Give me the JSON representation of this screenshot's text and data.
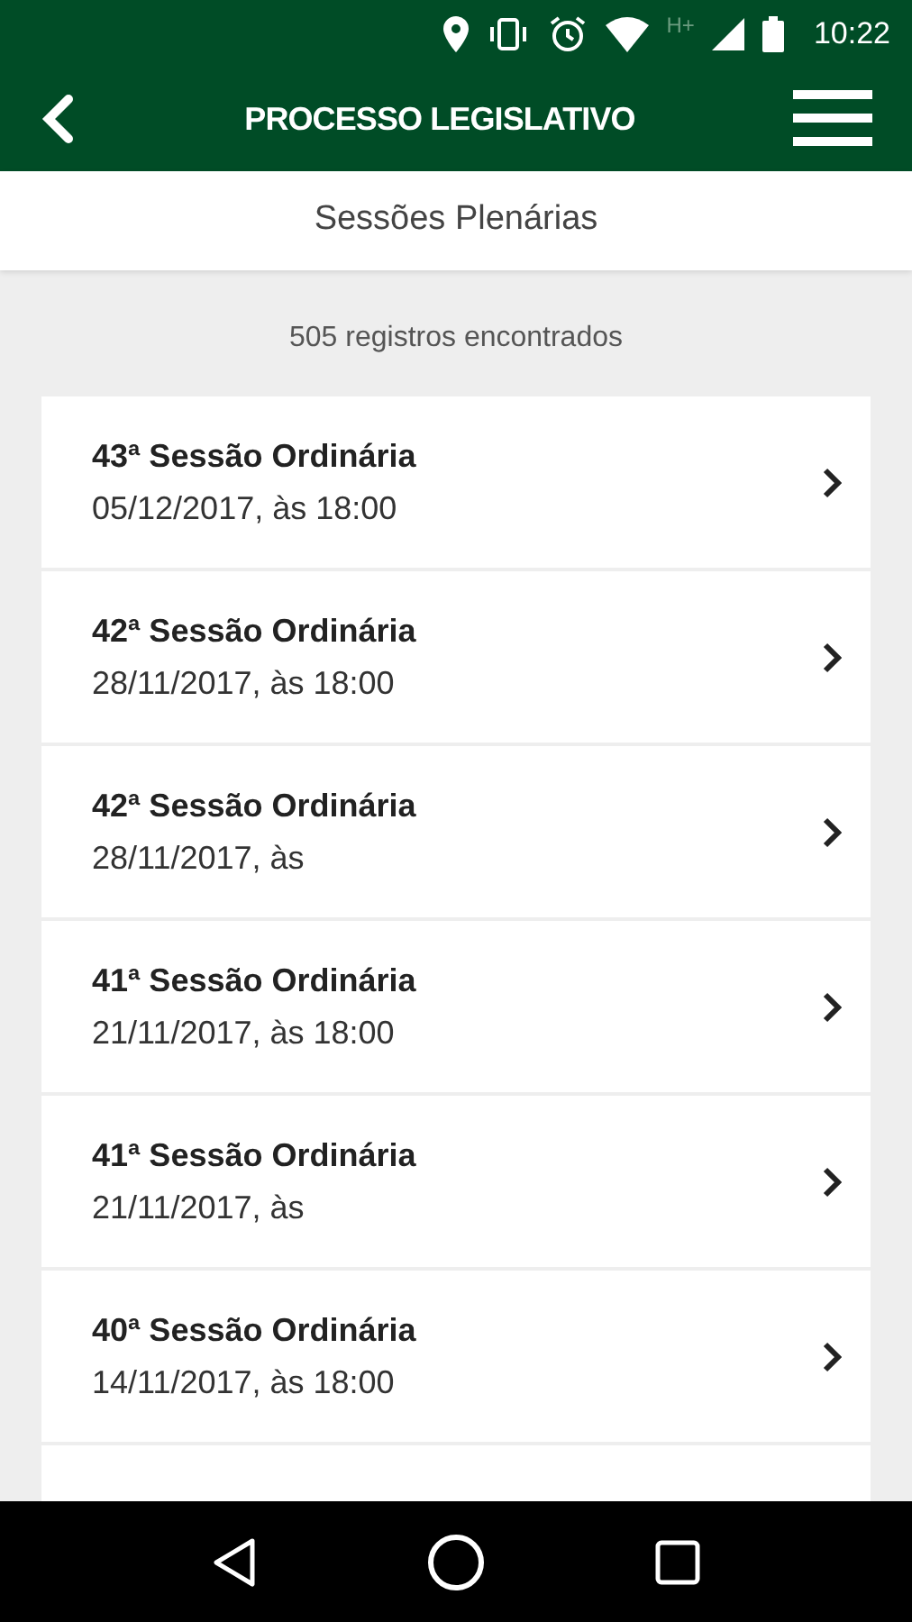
{
  "status_bar": {
    "network": "H+",
    "time": "10:22"
  },
  "app_bar": {
    "title": "PROCESSO LEGISLATIVO"
  },
  "subheader": {
    "title": "Sessões Plenárias"
  },
  "result_count": "505 registros encontrados",
  "sessions": [
    {
      "title": "43ª Sessão Ordinária",
      "date": "05/12/2017, às 18:00"
    },
    {
      "title": "42ª Sessão Ordinária",
      "date": "28/11/2017, às 18:00"
    },
    {
      "title": "42ª Sessão Ordinária",
      "date": "28/11/2017, às"
    },
    {
      "title": "41ª Sessão Ordinária",
      "date": "21/11/2017, às 18:00"
    },
    {
      "title": "41ª Sessão Ordinária",
      "date": "21/11/2017, às"
    },
    {
      "title": "40ª Sessão Ordinária",
      "date": "14/11/2017, às 18:00"
    }
  ]
}
